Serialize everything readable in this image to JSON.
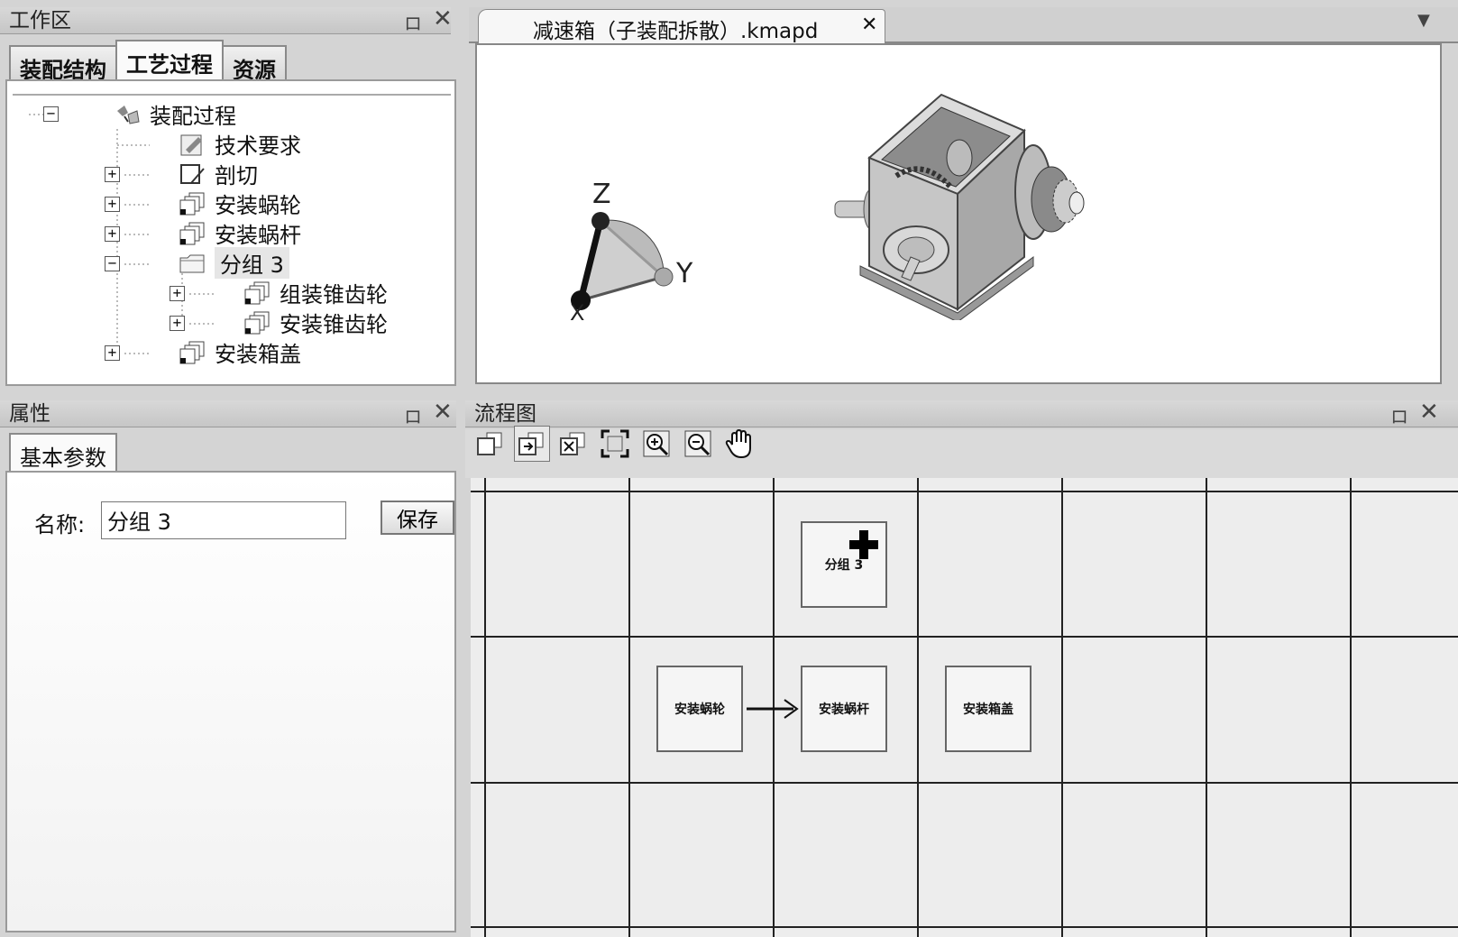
{
  "workspace": {
    "title": "工作区",
    "tabs": [
      "装配结构",
      "工艺过程",
      "资源"
    ],
    "tree": {
      "root": "装配过程",
      "items": [
        "技术要求",
        "剖切",
        "安装蜗轮",
        "安装蜗杆",
        "分组 3",
        "组装锥齿轮",
        "安装锥齿轮",
        "安装箱盖"
      ]
    }
  },
  "document": {
    "tab_label": "减速箱（子装配拆散）.kmapd",
    "axes": {
      "z": "Z",
      "y": "Y",
      "x": "X"
    }
  },
  "properties": {
    "title": "属性",
    "tab": "基本参数",
    "name_label": "名称:",
    "name_value": "分组 3",
    "save_label": "保存"
  },
  "flowchart": {
    "title": "流程图",
    "nodes": [
      "分组 3",
      "安装蜗轮",
      "安装蜗杆",
      "安装箱盖"
    ]
  },
  "icons": {
    "pin": "pin-icon",
    "close": "close-icon",
    "dropdown": "chevron-down-icon",
    "hand": "hand-pan-icon"
  }
}
